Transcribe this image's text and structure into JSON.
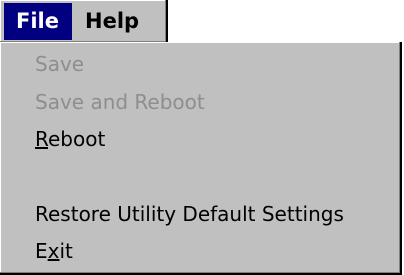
{
  "menubar": {
    "file_label": "File",
    "help_label": "Help"
  },
  "file_menu": {
    "items": [
      {
        "label": "Save",
        "enabled": false
      },
      {
        "label": "Save and Reboot",
        "enabled": false
      },
      {
        "label_mnemonic": "R",
        "label_rest": "eboot",
        "enabled": true
      },
      {
        "label": "Restore Utility Default Settings",
        "enabled": true
      },
      {
        "label_before": "E",
        "label_mnemonic": "x",
        "label_rest": "it",
        "enabled": true
      }
    ]
  }
}
